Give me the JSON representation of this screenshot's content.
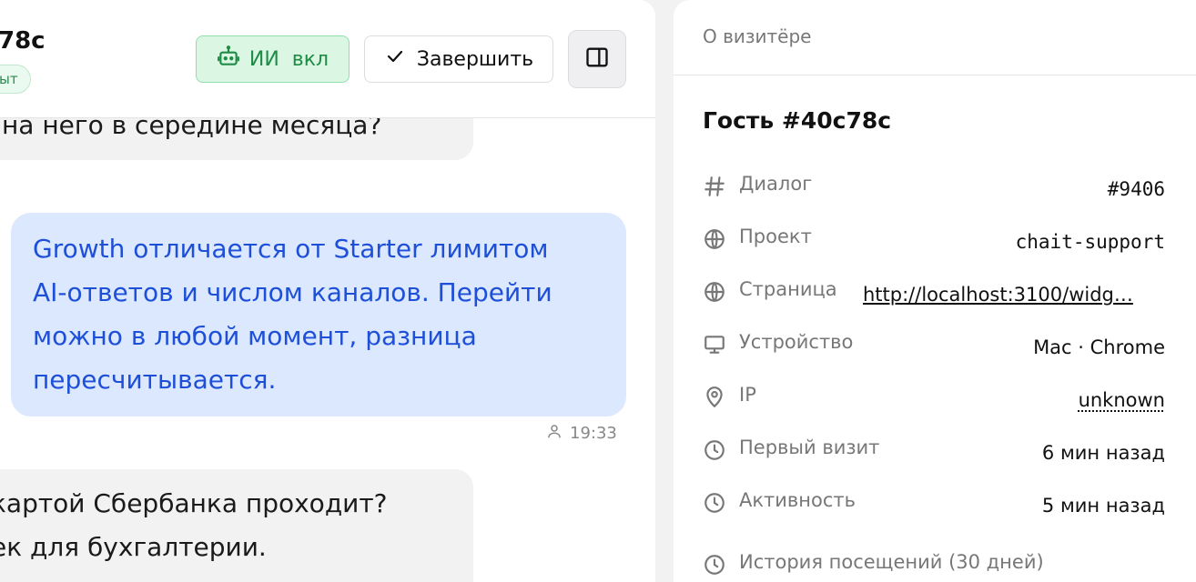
{
  "chat": {
    "header": {
      "visitor_name_partial": "78с",
      "status_chip": "ыт",
      "ai_button_label": "ИИ  вкл",
      "finish_button_label": "Завершить"
    },
    "messages": [
      {
        "lines": [
          "на него в середине месяца?"
        ]
      },
      {
        "lines": [
          "Growth отличается от Starter лимитом",
          "AI-ответов и числом каналов. Перейти",
          "можно в любой момент, разница",
          "пересчитывается."
        ],
        "time": "19:33"
      },
      {
        "lines": [
          "картой Сбербанка проходит?",
          "ек для бухгалтерии."
        ]
      }
    ]
  },
  "visitor": {
    "panel_title": "О визитёре",
    "guest_name": "Гость #40c78c",
    "rows": [
      {
        "icon": "hash-icon",
        "label": "Диалог",
        "value": "#9406"
      },
      {
        "icon": "globe-icon",
        "label": "Проект",
        "value": "chait-support"
      },
      {
        "icon": "globe-icon",
        "label": "Страница",
        "value": "http://localhost:3100/widg…"
      },
      {
        "icon": "monitor-icon",
        "label": "Устройство",
        "value": "Mac · Chrome"
      },
      {
        "icon": "map-pin-icon",
        "label": "IP",
        "value": "unknown"
      },
      {
        "icon": "clock-icon",
        "label": "Первый визит",
        "value": "6 мин назад"
      },
      {
        "icon": "clock-icon",
        "label": "Активность",
        "value": "5 мин назад"
      },
      {
        "icon": "clock-icon",
        "label": "История посещений (30 дней)"
      }
    ]
  },
  "colors": {
    "ai_green": "#1f8c45",
    "outgoing_bubble_bg": "#dbe8fd",
    "outgoing_text": "#1e4fd8",
    "incoming_bubble_bg": "#f2f2f3"
  }
}
